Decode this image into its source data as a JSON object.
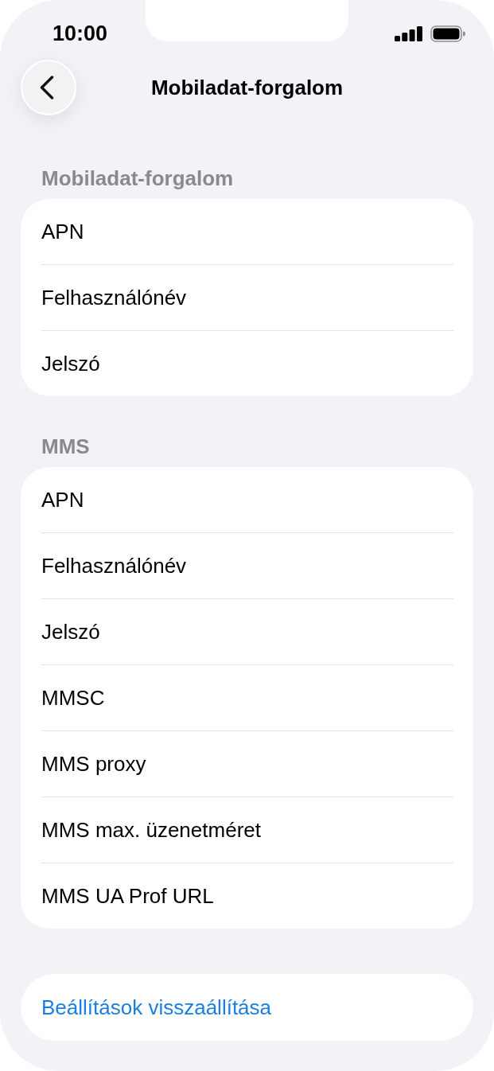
{
  "status_bar": {
    "time": "10:00"
  },
  "nav": {
    "title": "Mobiladat-forgalom"
  },
  "sections": [
    {
      "header": "Mobiladat-forgalom",
      "rows": [
        {
          "label": "APN"
        },
        {
          "label": "Felhasználónév"
        },
        {
          "label": "Jelszó"
        }
      ]
    },
    {
      "header": "MMS",
      "rows": [
        {
          "label": "APN"
        },
        {
          "label": "Felhasználónév"
        },
        {
          "label": "Jelszó"
        },
        {
          "label": "MMSC"
        },
        {
          "label": "MMS proxy"
        },
        {
          "label": "MMS max. üzenetméret"
        },
        {
          "label": "MMS UA Prof URL"
        }
      ]
    }
  ],
  "reset": {
    "label": "Beállítások visszaállítása"
  }
}
